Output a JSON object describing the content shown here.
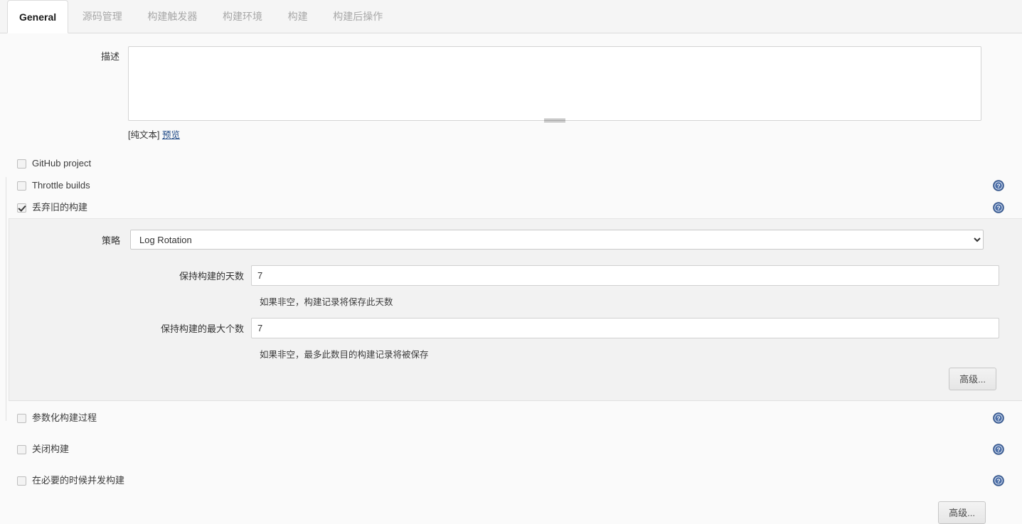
{
  "tabs": [
    {
      "label": "General",
      "active": true
    },
    {
      "label": "源码管理",
      "active": false
    },
    {
      "label": "构建触发器",
      "active": false
    },
    {
      "label": "构建环境",
      "active": false
    },
    {
      "label": "构建",
      "active": false
    },
    {
      "label": "构建后操作",
      "active": false
    }
  ],
  "description": {
    "label": "描述",
    "value": "",
    "placeholder": "",
    "plain_text_note": "[纯文本]",
    "preview_link": "预览"
  },
  "options": [
    {
      "label": "GitHub project",
      "checked": false,
      "help": false
    },
    {
      "label": "Throttle builds",
      "checked": false,
      "help": true
    },
    {
      "label": "丢弃旧的构建",
      "checked": true,
      "help": true
    }
  ],
  "discard_panel": {
    "strategy_label": "策略",
    "strategy_value": "Log Rotation",
    "strategy_options": [
      "Log Rotation"
    ],
    "days_label": "保持构建的天数",
    "days_value": "7",
    "days_hint": "如果非空，构建记录将保存此天数",
    "max_label": "保持构建的最大个数",
    "max_value": "7",
    "max_hint": "如果非空，最多此数目的构建记录将被保存",
    "advanced_button": "高级..."
  },
  "bottom_options": [
    {
      "label": "参数化构建过程",
      "checked": false,
      "help": true
    },
    {
      "label": "关闭构建",
      "checked": false,
      "help": true
    },
    {
      "label": "在必要的时候并发构建",
      "checked": false,
      "help": true
    }
  ],
  "footer": {
    "advanced_button": "高级..."
  },
  "colors": {
    "help_icon": "#4a6da7",
    "link": "#204a87",
    "panel_bg": "#f2f2f2",
    "page_bg": "#fafafa"
  },
  "icons": {
    "help": "help-icon",
    "dropdown": "chevron-down-icon",
    "resize": "resize-grip-icon"
  }
}
